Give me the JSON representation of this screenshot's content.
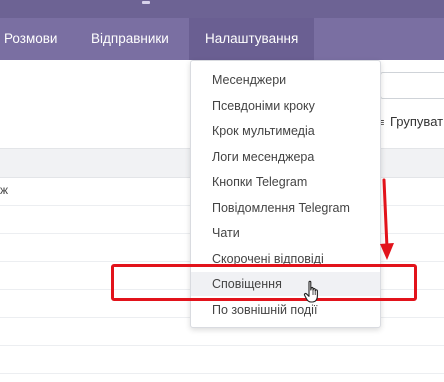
{
  "navbar": {
    "items": [
      {
        "label": "Розмови",
        "active": false
      },
      {
        "label": "Відправники",
        "active": false
      },
      {
        "label": "Налаштування",
        "active": true
      }
    ]
  },
  "toolbar": {
    "group_label": "Групувати",
    "group_icon": "list-icon"
  },
  "table": {
    "first_row_fragment": "ж"
  },
  "settings_menu": {
    "items": [
      {
        "label": "Месенджери"
      },
      {
        "label": "Псевдоніми кроку"
      },
      {
        "label": "Крок мультимедіа"
      },
      {
        "label": "Логи месенджера"
      },
      {
        "label": "Кнопки Telegram"
      },
      {
        "label": "Повідомлення Telegram"
      },
      {
        "label": "Чати"
      },
      {
        "label": "Скорочені відповіді"
      },
      {
        "label": "Сповіщення",
        "hovered": true
      },
      {
        "label": "По зовнішній події"
      }
    ]
  },
  "annotation": {
    "color": "#e2131b"
  },
  "theme": {
    "navbar_color": "#7a6fa2",
    "active_nav_color": "#6a5f92"
  }
}
